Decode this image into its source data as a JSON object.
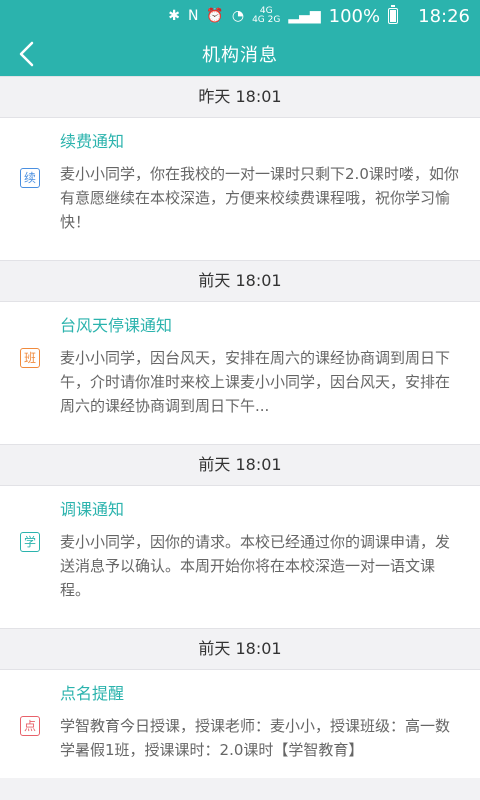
{
  "status_bar": {
    "battery": "100%",
    "time": "18:26",
    "net_top": "4G",
    "net_bottom": "4G 2G"
  },
  "app_bar": {
    "title": "机构消息"
  },
  "messages": [
    {
      "time": "昨天 18:01",
      "title": "续费通知",
      "tag": "续",
      "tag_color": "#4a8fe0",
      "body": "麦小小同学，你在我校的一对一课时只剩下2.0课时喽，如你有意愿继续在本校深造，方便来校续费课程哦，祝你学习愉快！"
    },
    {
      "time": "前天 18:01",
      "title": "台风天停课通知",
      "tag": "班",
      "tag_color": "#f08a3c",
      "body": "麦小小同学，因台风天，安排在周六的课经协商调到周日下午，介时请你准时来校上课麦小小同学，因台风天，安排在周六的课经协商调到周日下午..."
    },
    {
      "time": "前天 18:01",
      "title": "调课通知",
      "tag": "学",
      "tag_color": "#2bb3ad",
      "body": "麦小小同学，因你的请求。本校已经通过你的调课申请，发送消息予以确认。本周开始你将在本校深造一对一语文课程。"
    },
    {
      "time": "前天 18:01",
      "title": "点名提醒",
      "tag": "点",
      "tag_color": "#e8616a",
      "body": "学智教育今日授课，授课老师：麦小小，授课班级：高一数学暑假1班，授课课时：2.0课时【学智教育】"
    }
  ]
}
